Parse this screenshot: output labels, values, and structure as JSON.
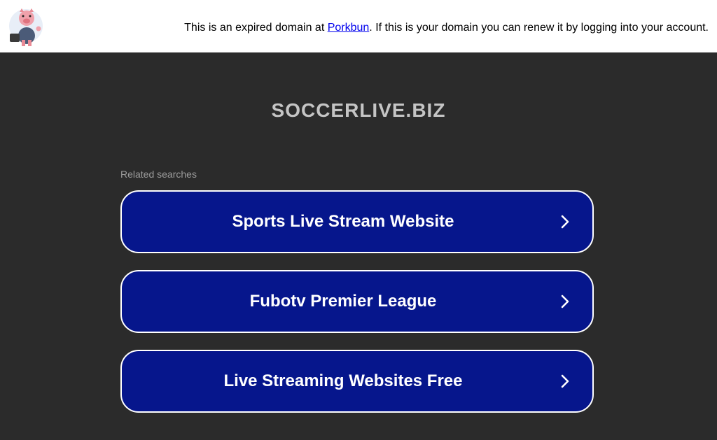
{
  "topbar": {
    "notice_prefix": "This is an expired domain at ",
    "notice_link": "Porkbun",
    "notice_suffix": ". If this is your domain you can renew it by logging into your account."
  },
  "main": {
    "domain": "SOCCERLIVE.BIZ",
    "related_label": "Related searches",
    "searches": [
      {
        "label": "Sports Live Stream Website"
      },
      {
        "label": "Fubotv Premier League"
      },
      {
        "label": "Live Streaming Websites Free"
      }
    ]
  },
  "colors": {
    "background": "#2b2b2b",
    "button": "#06168c",
    "title": "#c5c5c5"
  },
  "icons": [
    "porkbun-pig-logo-icon",
    "chevron-right-icon"
  ]
}
